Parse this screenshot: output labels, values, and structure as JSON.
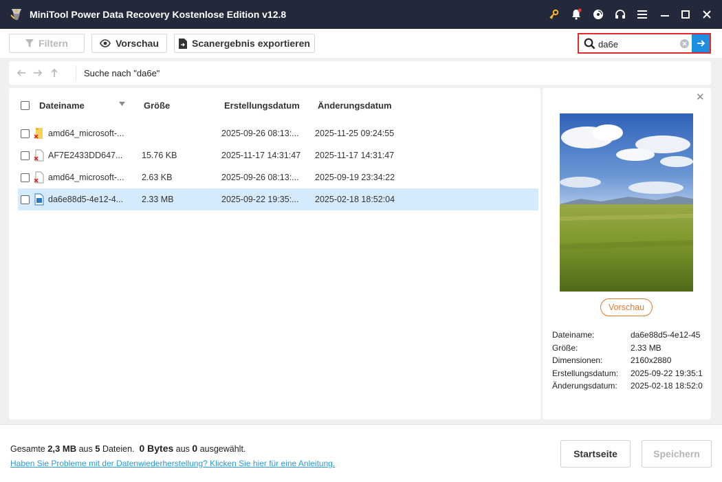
{
  "app": {
    "title": "MiniTool Power Data Recovery Kostenlose Edition v12.8"
  },
  "title_icons": [
    "key-icon",
    "bell-icon",
    "disc-icon",
    "headset-icon",
    "menu-icon",
    "minimize-icon",
    "maximize-icon",
    "close-icon"
  ],
  "toolbar": {
    "filter_label": "Filtern",
    "preview_label": "Vorschau",
    "export_label": "Scanergebnis exportieren"
  },
  "search": {
    "value": "da6e"
  },
  "nav": {
    "path": "Suche nach \"da6e\""
  },
  "table": {
    "headers": {
      "name": "Dateiname",
      "size": "Größe",
      "created": "Erstellungsdatum",
      "modified": "Änderungsdatum"
    },
    "rows": [
      {
        "name": "amd64_microsoft-...",
        "size": "",
        "created": "2025-09-26 08:13:...",
        "modified": "2025-11-25 09:24:55",
        "icon": "folder-deleted-icon"
      },
      {
        "name": "AF7E2433DD647...",
        "size": "15.76 KB",
        "created": "2025-11-17 14:31:47",
        "modified": "2025-11-17 14:31:47",
        "icon": "file-deleted-icon"
      },
      {
        "name": "amd64_microsoft-...",
        "size": "2.63 KB",
        "created": "2025-09-26 08:13:...",
        "modified": "2025-09-19 23:34:22",
        "icon": "file-deleted-icon"
      },
      {
        "name": "da6e88d5-4e12-4...",
        "size": "2.33 MB",
        "created": "2025-09-22 19:35:...",
        "modified": "2025-02-18 18:52:04",
        "icon": "image-file-icon"
      }
    ]
  },
  "preview": {
    "button_label": "Vorschau",
    "fields": [
      {
        "key": "Dateiname:",
        "value": "da6e88d5-4e12-45"
      },
      {
        "key": "Größe:",
        "value": "2.33 MB"
      },
      {
        "key": "Dimensionen:",
        "value": "2160x2880"
      },
      {
        "key": "Erstellungsdatum:",
        "value": "2025-09-22 19:35:1"
      },
      {
        "key": "Änderungsdatum:",
        "value": "2025-02-18 18:52:0"
      }
    ]
  },
  "footer": {
    "stats_prefix": "Gesamte",
    "total_size": "2,3 MB",
    "stats_mid": "aus",
    "file_count": "5",
    "stats_files": "Dateien.",
    "selected_size": "0 Bytes",
    "stats_aus": "aus",
    "selected_count": "0",
    "stats_selected": "ausgewählt.",
    "help_link": "Haben Sie Probleme mit der Datenwiederherstellung? Klicken Sie hier für eine Anleitung.",
    "home_button": "Startseite",
    "save_button": "Speichern"
  },
  "colors": {
    "titlebar": "#23283a",
    "accent": "#1e8fe0",
    "highlight_border": "#e02a2a",
    "selected_row": "#d5ebfb",
    "preview_button": "#e07a2a",
    "link": "#2a9ad6"
  }
}
